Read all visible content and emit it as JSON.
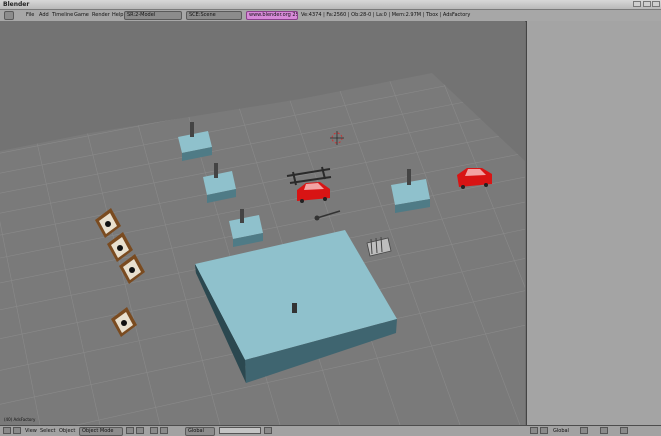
{
  "window": {
    "title": "Blender"
  },
  "menubar": {
    "items": [
      "File",
      "Add",
      "Timeline",
      "Game",
      "Render",
      "Help"
    ],
    "layout_field": "SR:2-Model",
    "scene_field": "SCE:Scene",
    "engine_label": "www.blender.org 250",
    "stats": "Ve:4374 | Fa:2560 | Ob:28-0 | La:0 | Mem:2.97M | Tbox | AdsFactory"
  },
  "viewport": {
    "object_name": "(40) AdsFactory"
  },
  "footer": {
    "view": "View",
    "select": "Select",
    "object": "Object",
    "mode": "Object Mode",
    "pivot": "Global",
    "right_label": "Global"
  },
  "colors": {
    "background": "#737373",
    "grid": "#888888",
    "floor": "#8fc1cc",
    "car": "#d81414"
  }
}
